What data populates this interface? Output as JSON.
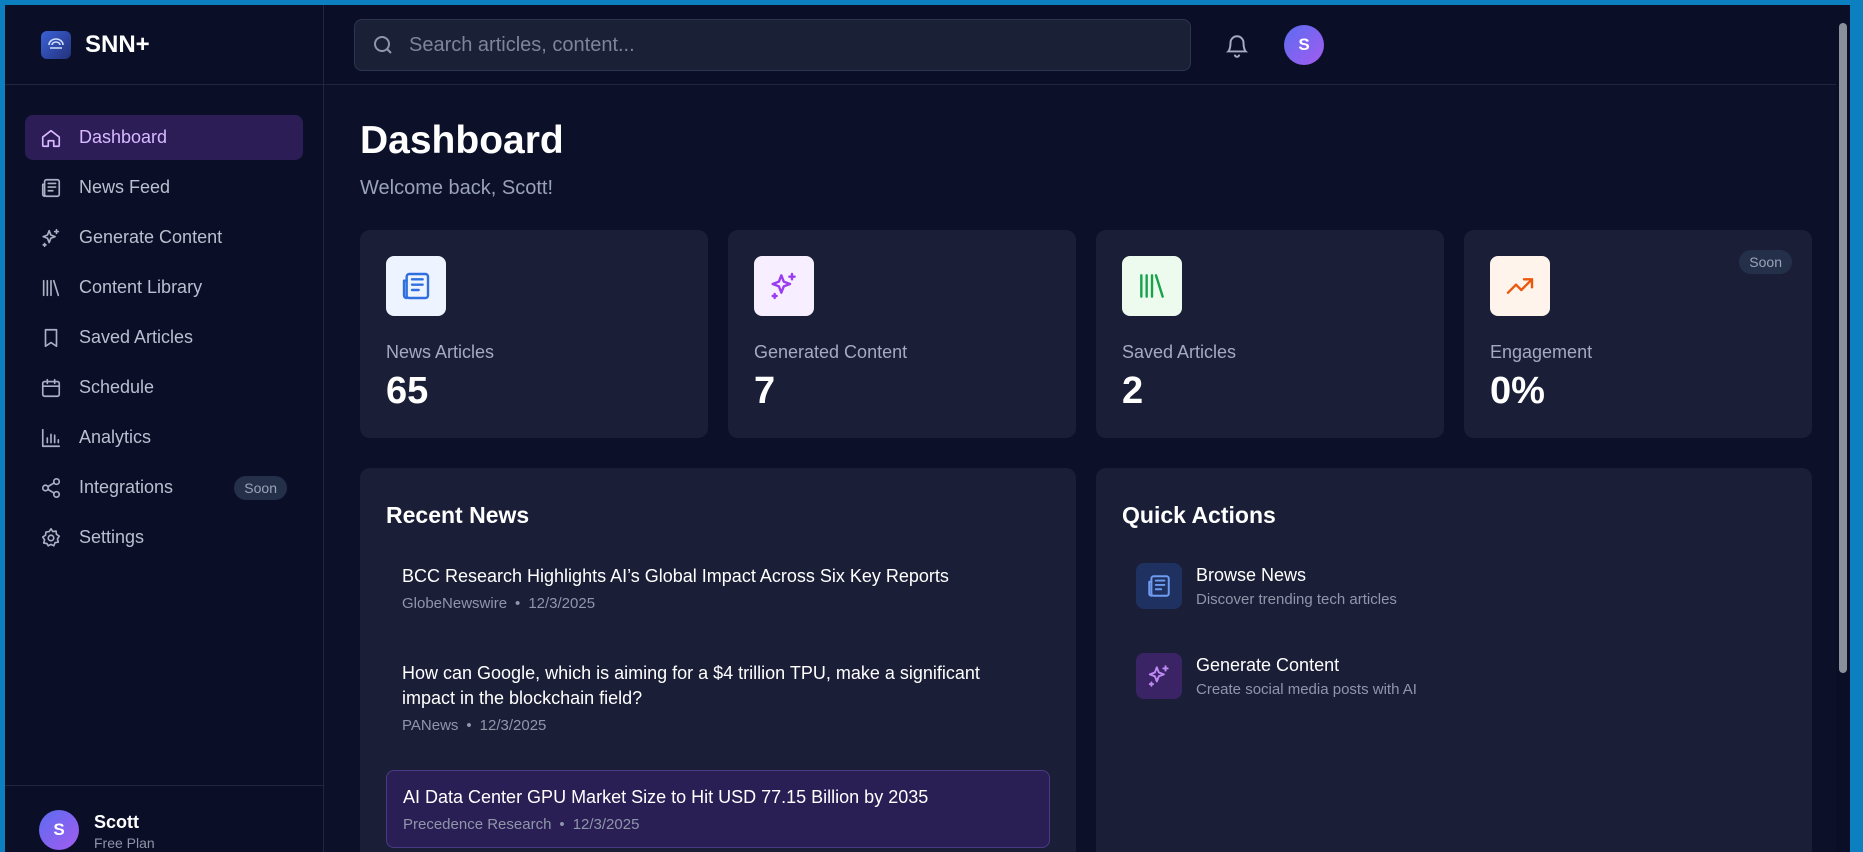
{
  "brand": {
    "name": "SNN+",
    "logo": "snn-logo-icon"
  },
  "search": {
    "placeholder": "Search articles, content..."
  },
  "header": {
    "user_initial": "S"
  },
  "sidebar": {
    "items": [
      {
        "label": "Dashboard",
        "icon": "home-icon",
        "active": true
      },
      {
        "label": "News Feed",
        "icon": "newspaper-icon"
      },
      {
        "label": "Generate Content",
        "icon": "sparkles-icon"
      },
      {
        "label": "Content Library",
        "icon": "library-icon"
      },
      {
        "label": "Saved Articles",
        "icon": "bookmark-icon"
      },
      {
        "label": "Schedule",
        "icon": "calendar-icon"
      },
      {
        "label": "Analytics",
        "icon": "bar-chart-icon"
      },
      {
        "label": "Integrations",
        "icon": "share-icon",
        "badge": "Soon"
      },
      {
        "label": "Settings",
        "icon": "gear-icon"
      }
    ],
    "user": {
      "initial": "S",
      "name": "Scott",
      "plan": "Free Plan"
    }
  },
  "main": {
    "title": "Dashboard",
    "subtitle": "Welcome back, Scott!",
    "stats": [
      {
        "label": "News Articles",
        "value": "65",
        "icon": "newspaper-icon",
        "color": "#2f6fe0"
      },
      {
        "label": "Generated Content",
        "value": "7",
        "icon": "sparkles-icon",
        "color": "#9b3cf0"
      },
      {
        "label": "Saved Articles",
        "value": "2",
        "icon": "library-icon",
        "color": "#16a34a"
      },
      {
        "label": "Engagement",
        "value": "0%",
        "icon": "trending-up-icon",
        "color": "#ea580c",
        "badge": "Soon"
      }
    ],
    "recent_news": {
      "title": "Recent News",
      "items": [
        {
          "title": "BCC Research Highlights AI’s Global Impact Across Six Key Reports",
          "source": "GlobeNewswire",
          "date": "12/3/2025"
        },
        {
          "title": "How can Google, which is aiming for a $4 trillion TPU, make a significant impact in the blockchain field?",
          "source": "PANews",
          "date": "12/3/2025"
        },
        {
          "title": "AI Data Center GPU Market Size to Hit USD 77.15 Billion by 2035",
          "source": "Precedence Research",
          "date": "12/3/2025"
        }
      ]
    },
    "quick_actions": {
      "title": "Quick Actions",
      "items": [
        {
          "title": "Browse News",
          "desc": "Discover trending tech articles",
          "icon": "newspaper-icon"
        },
        {
          "title": "Generate Content",
          "desc": "Create social media posts with AI",
          "icon": "sparkles-icon"
        }
      ]
    }
  },
  "colors": {
    "accent": "#d8b9ff",
    "active_bg": "#2c1d57",
    "card_bg": "#1a1f37",
    "page_bg": "#0c1129"
  }
}
